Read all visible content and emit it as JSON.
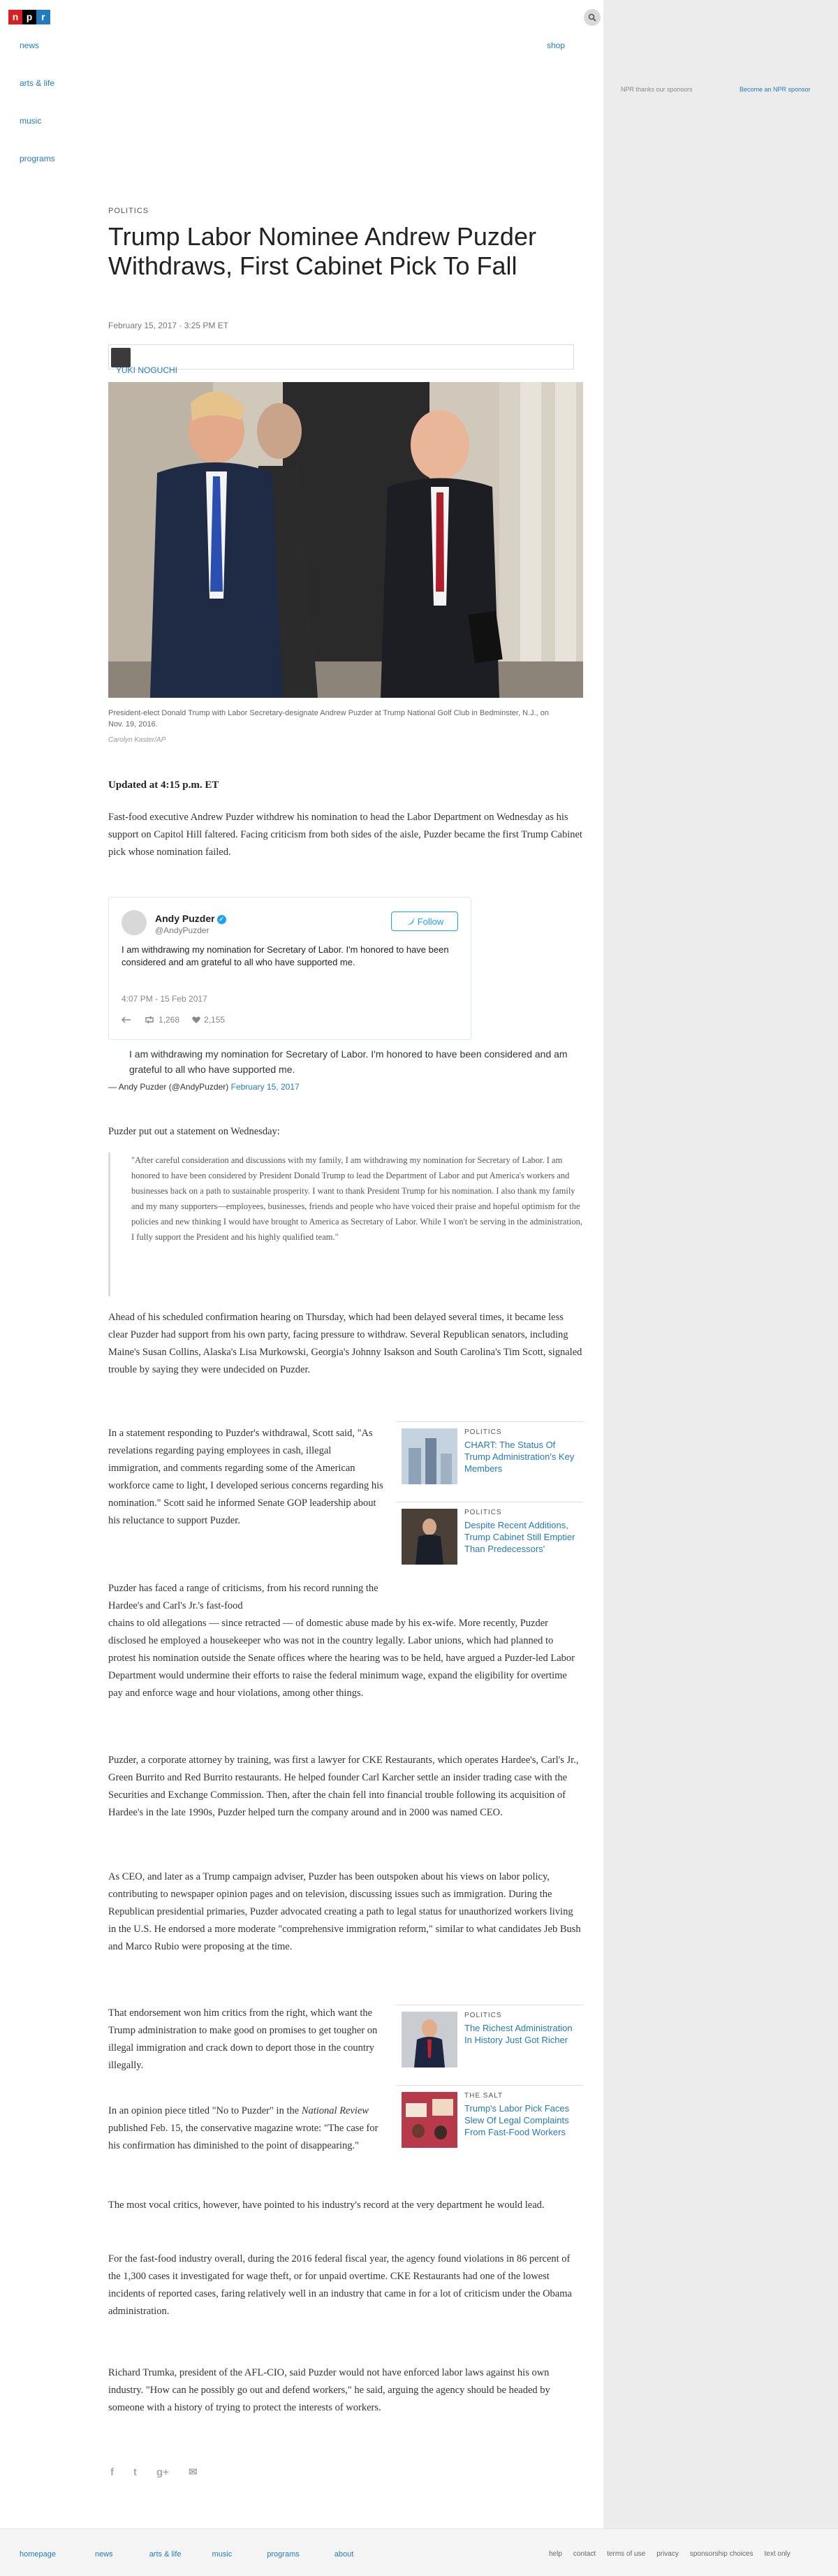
{
  "header": {
    "logo_letters": [
      "n",
      "p",
      "r"
    ],
    "nav": [
      "news",
      "arts & life",
      "music",
      "programs"
    ],
    "shop_label": "shop",
    "search_icon": "search-icon"
  },
  "sponsor": {
    "thanks": "NPR thanks our sponsors",
    "become": "Become an NPR sponsor"
  },
  "article": {
    "slug": "POLITICS",
    "title": "Trump Labor Nominee Andrew Puzder Withdraws, First Cabinet Pick To Fall",
    "date": "February 15, 2017 · 3:25 PM ET",
    "byline": "YUKI NOGUCHI",
    "photo_caption": "President-elect Donald Trump with Labor Secretary-designate Andrew Puzder at Trump National Golf Club in Bedminster, N.J., on Nov. 19, 2016.",
    "photo_credit": "Carolyn Kaster/AP",
    "updated": "Updated at 4:15 p.m. ET",
    "p1": "Fast-food executive Andrew Puzder withdrew his nomination to head the Labor Department on Wednesday as his support on Capitol Hill faltered. Facing criticism from both sides of the aisle, Puzder became the first Trump Cabinet pick whose nomination failed.",
    "p_statement_intro": "Puzder put out a statement on Wednesday:",
    "statement": "\"After careful consideration and discussions with my family, I am withdrawing my nomination for Secretary of Labor. I am honored to have been considered by President Donald Trump to lead the Department of Labor and put America's workers and businesses back on a path to sustainable prosperity. I want to thank President Trump for his nomination. I also thank my family and my many supporters—employees, businesses, friends and people who have voiced their praise and hopeful optimism for the policies and new thinking I would have brought to America as Secretary of Labor. While I won't be serving in the administration, I fully support the President and his highly qualified team.\"",
    "p2": "Ahead of his scheduled confirmation hearing on Thursday, which had been delayed several times, it became less clear Puzder had support from his own party, facing pressure to withdraw. Several Republican senators, including Maine's Susan Collins, Alaska's Lisa Murkowski, Georgia's Johnny Isakson and South Carolina's Tim Scott, signaled trouble by saying they were undecided on Puzder.",
    "p3": "In a statement responding to Puzder's withdrawal, Scott said, \"As revelations regarding paying employees in cash, illegal immigration, and comments regarding some of the American workforce came to light, I developed serious concerns regarding his nomination.\" Scott said he informed Senate GOP leadership about his reluctance to support Puzder.",
    "p4a": "Puzder has faced a range of criticisms, from his record running the Hardee's and Carl's Jr.'s fast-food",
    "p4b": "chains to old allegations — since retracted — of domestic abuse made by his ex-wife. More recently, Puzder disclosed he employed a housekeeper who was not in the country legally. Labor unions, which had planned to protest his nomination outside the Senate offices where the hearing was to be held, have argued a Puzder-led Labor Department would undermine their efforts to raise the federal minimum wage, expand the eligibility for overtime pay and enforce wage and hour violations, among other things.",
    "p5": "Puzder, a corporate attorney by training, was first a lawyer for CKE Restaurants, which operates Hardee's, Carl's Jr., Green Burrito and Red Burrito restaurants. He helped founder Carl Karcher settle an insider trading case with the Securities and Exchange Commission. Then, after the chain fell into financial trouble following its acquisition of Hardee's in the late 1990s, Puzder helped turn the company around and in 2000 was named CEO.",
    "p6": "As CEO, and later as a Trump campaign adviser, Puzder has been outspoken about his views on labor policy, contributing to newspaper opinion pages and on television, discussing issues such as immigration. During the Republican presidential primaries, Puzder advocated creating a path to legal status for unauthorized workers living in the U.S. He endorsed a more moderate \"comprehensive immigration reform,\" similar to what candidates Jeb Bush and Marco Rubio were proposing at the time.",
    "p7": "That endorsement won him critics from the right, which want the Trump administration to make good on promises to get tougher on illegal immigration and crack down to deport those in the country illegally.",
    "p8_pre": "In an opinion piece titled \"No to Puzder\" in the ",
    "p8_em": "National Review",
    "p8_post": " published Feb. 15, the conservative magazine wrote: \"The case for his confirmation has diminished to the point of disappearing.\"",
    "p9": "The most vocal critics, however, have pointed to his industry's record at the very department he would lead.",
    "p10": "For the fast-food industry overall, during the 2016 federal fiscal year, the agency found violations in 86 percent of the 1,300 cases it investigated for wage theft, or for unpaid overtime. CKE Restaurants had one of the lowest incidents of reported cases, faring relatively well in an industry that came in for a lot of criticism under the Obama administration.",
    "p11": "Richard Trumka, president of the AFL-CIO, said Puzder would not have enforced labor laws against his own industry. \"How can he possibly go out and defend workers,\" he said, arguing the agency should be headed by someone with a history of trying to protect the interests of workers."
  },
  "tweet": {
    "name": "Andy Puzder",
    "handle": "@AndyPuzder",
    "follow": "Follow",
    "text": "I am withdrawing my nomination for Secretary of Labor. I'm honored to have been considered and am grateful to all who have supported me.",
    "time": "4:07 PM - 15 Feb 2017",
    "retweets": "1,268",
    "likes": "2,155",
    "embed_quote": "I am withdrawing my nomination for Secretary of Labor. I'm honored to have been considered and am grateful to all who have supported me.",
    "embed_attr": "— Andy Puzder (@AndyPuzder)",
    "embed_date": "February 15, 2017"
  },
  "related": [
    {
      "slug": "POLITICS",
      "title": "CHART: The Status Of Trump Administration's Key Members"
    },
    {
      "slug": "POLITICS",
      "title": "Despite Recent Additions, Trump Cabinet Still Emptier Than Predecessors'"
    },
    {
      "slug": "POLITICS",
      "title": "The Richest Administration In History Just Got Richer"
    },
    {
      "slug": "THE SALT",
      "title": "Trump's Labor Pick Faces Slew Of Legal Complaints From Fast-Food Workers"
    }
  ],
  "social": [
    "f",
    "t",
    "g+",
    "✉"
  ],
  "footer": {
    "left": [
      "homepage",
      "news",
      "arts & life",
      "music",
      "programs",
      "about"
    ],
    "right": [
      "help",
      "contact",
      "terms of use",
      "privacy",
      "sponsorship choices",
      "text only"
    ]
  }
}
